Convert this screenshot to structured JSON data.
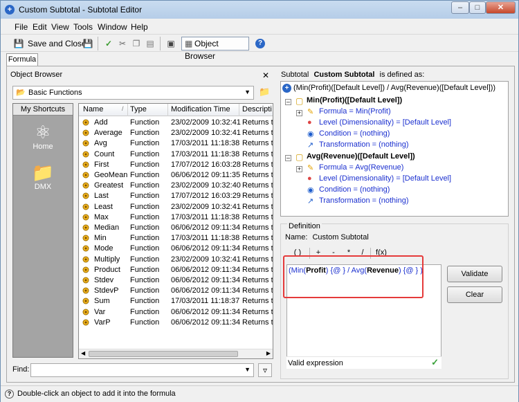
{
  "window": {
    "title": "Custom Subtotal - Subtotal Editor"
  },
  "menu": [
    "File",
    "Edit",
    "View",
    "Tools",
    "Window",
    "Help"
  ],
  "toolbar": {
    "save_close": "Save and Close",
    "object_browser": "Object Browser"
  },
  "tabs": [
    "Formula"
  ],
  "object_browser": {
    "title": "Object Browser",
    "category": "Basic Functions",
    "shortcuts_header": "My Shortcuts",
    "shortcuts": [
      "Home",
      "DMX"
    ],
    "columns": [
      "Name",
      "Type",
      "Modification Time",
      "Descripti"
    ],
    "rows": [
      [
        "Add",
        "Function",
        "23/02/2009 10:32:41",
        "Returns t"
      ],
      [
        "Average",
        "Function",
        "23/02/2009 10:32:41",
        "Returns t"
      ],
      [
        "Avg",
        "Function",
        "17/03/2011 11:18:38",
        "Returns t"
      ],
      [
        "Count",
        "Function",
        "17/03/2011 11:18:38",
        "Returns t"
      ],
      [
        "First",
        "Function",
        "17/07/2012 16:03:28",
        "Returns t"
      ],
      [
        "GeoMean",
        "Function",
        "06/06/2012 09:11:35",
        "Returns t"
      ],
      [
        "Greatest",
        "Function",
        "23/02/2009 10:32:40",
        "Returns t"
      ],
      [
        "Last",
        "Function",
        "17/07/2012 16:03:29",
        "Returns t"
      ],
      [
        "Least",
        "Function",
        "23/02/2009 10:32:41",
        "Returns t"
      ],
      [
        "Max",
        "Function",
        "17/03/2011 11:18:38",
        "Returns t"
      ],
      [
        "Median",
        "Function",
        "06/06/2012 09:11:34",
        "Returns t"
      ],
      [
        "Min",
        "Function",
        "17/03/2011 11:18:38",
        "Returns t"
      ],
      [
        "Mode",
        "Function",
        "06/06/2012 09:11:34",
        "Returns t"
      ],
      [
        "Multiply",
        "Function",
        "23/02/2009 10:32:41",
        "Returns t"
      ],
      [
        "Product",
        "Function",
        "06/06/2012 09:11:34",
        "Returns t"
      ],
      [
        "Stdev",
        "Function",
        "06/06/2012 09:11:34",
        "Returns t"
      ],
      [
        "StdevP",
        "Function",
        "06/06/2012 09:11:34",
        "Returns t"
      ],
      [
        "Sum",
        "Function",
        "17/03/2011 11:18:37",
        "Returns t"
      ],
      [
        "Var",
        "Function",
        "06/06/2012 09:11:34",
        "Returns t"
      ],
      [
        "VarP",
        "Function",
        "06/06/2012 09:11:34",
        "Returns t"
      ]
    ],
    "find_label": "Find:",
    "find_value": ""
  },
  "definition_tree": {
    "prefix": "Subtotal",
    "name": "Custom Subtotal",
    "suffix": "is defined as:",
    "root": "(Min(Profit)([Default Level]) / Avg(Revenue)([Default Level]))",
    "groups": [
      {
        "label": "Min(Profit)([Default Level])",
        "formula": "Formula = Min(Profit)",
        "level": "Level (Dimensionality) = [Default Level]",
        "condition": "Condition = (nothing)",
        "transformation": "Transformation = (nothing)"
      },
      {
        "label": "Avg(Revenue)([Default Level])",
        "formula": "Formula = Avg(Revenue)",
        "level": "Level (Dimensionality) = [Default Level]",
        "condition": "Condition = (nothing)",
        "transformation": "Transformation = (nothing)"
      }
    ]
  },
  "definition": {
    "title": "Definition",
    "name_label": "Name:",
    "name_value": "Custom Subtotal",
    "operators": [
      "( )",
      "+",
      "-",
      "*",
      "/",
      "f(x)"
    ],
    "formula_parts": {
      "p1": "(Min(",
      "p2": "Profit",
      "p3": ") {@ } / Avg(",
      "p4": "Revenue",
      "p5": ") {@ } )"
    },
    "status": "Valid expression",
    "validate": "Validate",
    "clear": "Clear"
  },
  "statusbar": {
    "text": "Double-click an object to add it into the formula"
  },
  "colors": {
    "accent": "#2b67c6",
    "link_blue": "#1a2fcf",
    "highlight_red": "#e53a3a"
  }
}
